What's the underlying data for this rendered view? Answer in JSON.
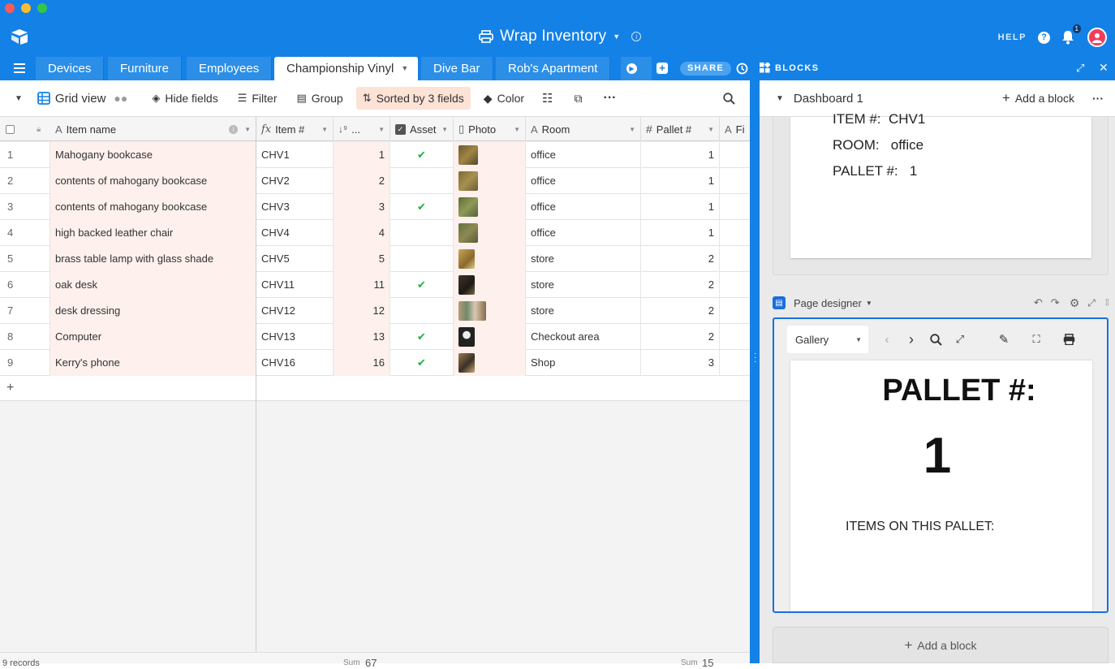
{
  "app": {
    "title": "Wrap Inventory",
    "help_label": "HELP",
    "notification_count": "1"
  },
  "tabs": [
    {
      "label": "Devices"
    },
    {
      "label": "Furniture"
    },
    {
      "label": "Employees"
    },
    {
      "label": "Championship Vinyl"
    },
    {
      "label": "Dive Bar"
    },
    {
      "label": "Rob's Apartment"
    }
  ],
  "share_label": "SHARE",
  "blocks_label": "BLOCKS",
  "viewbar": {
    "view_name": "Grid view",
    "hide_fields": "Hide fields",
    "filter": "Filter",
    "group": "Group",
    "sorted": "Sorted by 3 fields",
    "color": "Color"
  },
  "columns": {
    "item_name": "Item name",
    "item_no": "Item #",
    "order": "...",
    "asset": "Asset",
    "photo": "Photo",
    "room": "Room",
    "pallet": "Pallet #",
    "fi": "Fi"
  },
  "rows": [
    {
      "n": "1",
      "name": "Mahogany bookcase",
      "item": "CHV1",
      "ord": "1",
      "asset": true,
      "room": "office",
      "pallet": "1"
    },
    {
      "n": "2",
      "name": "contents of mahogany bookcase",
      "item": "CHV2",
      "ord": "2",
      "asset": false,
      "room": "office",
      "pallet": "1"
    },
    {
      "n": "3",
      "name": "contents of mahogany bookcase",
      "item": "CHV3",
      "ord": "3",
      "asset": true,
      "room": "office",
      "pallet": "1"
    },
    {
      "n": "4",
      "name": "high backed leather chair",
      "item": "CHV4",
      "ord": "4",
      "asset": false,
      "room": "office",
      "pallet": "1"
    },
    {
      "n": "5",
      "name": "brass table lamp with glass shade",
      "item": "CHV5",
      "ord": "5",
      "asset": false,
      "room": "store",
      "pallet": "2"
    },
    {
      "n": "6",
      "name": "oak desk",
      "item": "CHV11",
      "ord": "11",
      "asset": true,
      "room": "store",
      "pallet": "2"
    },
    {
      "n": "7",
      "name": "desk dressing",
      "item": "CHV12",
      "ord": "12",
      "asset": false,
      "room": "store",
      "pallet": "2"
    },
    {
      "n": "8",
      "name": "Computer",
      "item": "CHV13",
      "ord": "13",
      "asset": true,
      "room": "Checkout area",
      "pallet": "2"
    },
    {
      "n": "9",
      "name": "Kerry's phone",
      "item": "CHV16",
      "ord": "16",
      "asset": true,
      "room": "Shop",
      "pallet": "3"
    }
  ],
  "footer": {
    "records": "9 records",
    "sum_label": "Sum",
    "sum_order": "67",
    "sum_pallet": "15"
  },
  "dashboard": {
    "title": "Dashboard 1",
    "add_block": "Add a block",
    "record": {
      "item_label": "ITEM #:",
      "item_value": "CHV1",
      "room_label": "ROOM:",
      "room_value": "office",
      "pallet_label": "PALLET #:",
      "pallet_value": "1"
    },
    "page_designer": {
      "label": "Page designer",
      "gallery": "Gallery",
      "heading": "PALLET #:",
      "number": "1",
      "items_label": "ITEMS ON THIS PALLET:"
    },
    "add_block_bottom": "Add a block"
  },
  "colors": {
    "brand_blue": "#1481e6",
    "check_green": "#19b33f",
    "sorted_bg": "#fde2d6",
    "avatar": "#ef3e5c"
  }
}
